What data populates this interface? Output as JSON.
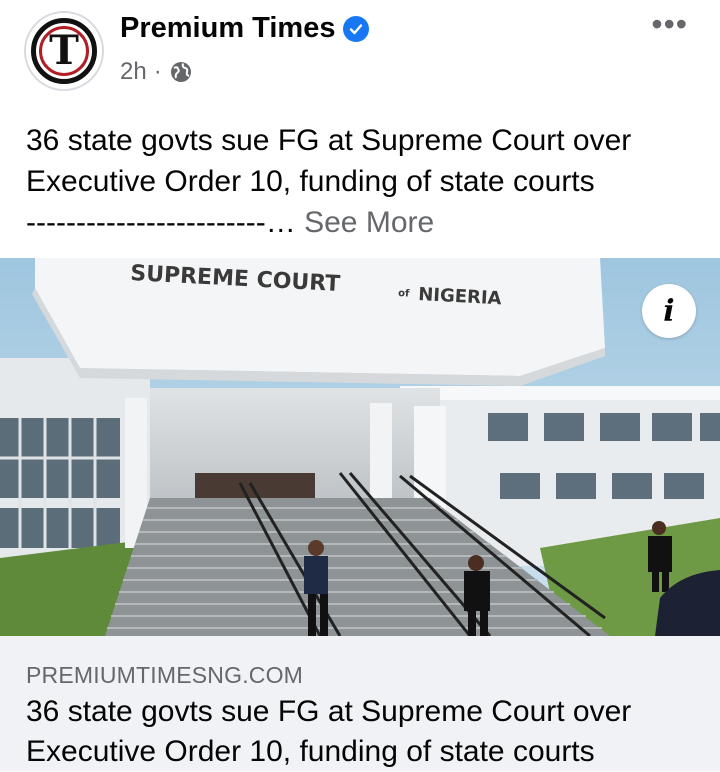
{
  "post": {
    "page_name": "Premium Times",
    "avatar_letter": "T",
    "time": "2h",
    "separator": "·",
    "audience_icon": "globe-icon",
    "more_icon": "more-horizontal-icon",
    "text_line1": "36 state govts sue FG at Supreme Court over",
    "text_line2": "Executive Order 10, funding of state courts",
    "text_line3": "------------------------…",
    "see_more": "See More"
  },
  "image": {
    "sign_text": "SUPREME COURT of NIGERIA",
    "info_icon": "i"
  },
  "link": {
    "domain": "PREMIUMTIMESNG.COM",
    "title_line1": "36 state govts sue FG at Supreme Court over",
    "title_line2": "Executive Order 10, funding of state courts"
  },
  "colors": {
    "verified": "#1877f2",
    "secondary_text": "#65676b",
    "card_bg": "#f0f2f5"
  }
}
